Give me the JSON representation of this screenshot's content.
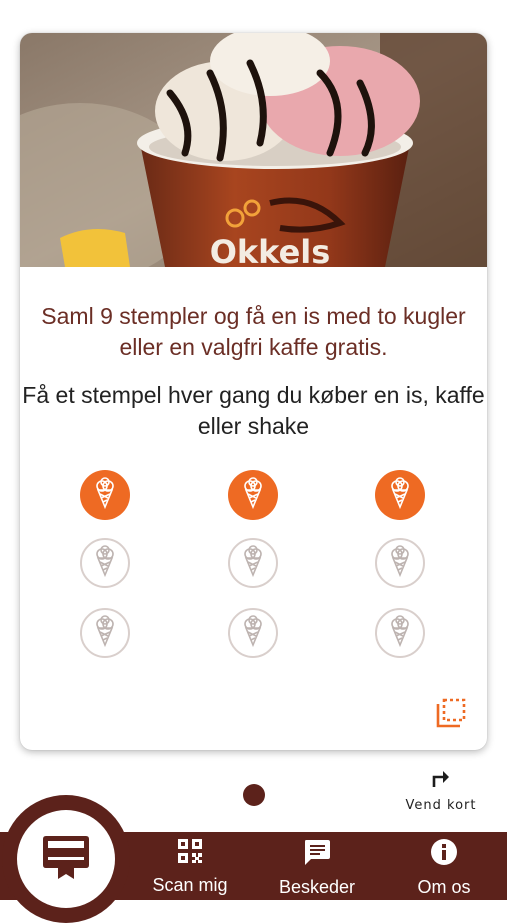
{
  "card": {
    "hero_image": {
      "alt_icon": "ice-cream-cup-photo",
      "brand_text": "Okkels"
    },
    "title": "Saml 9 stempler og få en is med to kugler eller en valgfri kaffe gratis.",
    "subtitle": "Få et stempel hver gang du køber en is, kaffe eller shake",
    "stamps": [
      {
        "filled": true
      },
      {
        "filled": true
      },
      {
        "filled": true
      },
      {
        "filled": false
      },
      {
        "filled": false
      },
      {
        "filled": false
      },
      {
        "filled": false
      },
      {
        "filled": false
      },
      {
        "filled": false
      }
    ],
    "stamps_collected": 3,
    "stamps_total": 9,
    "flip_icon": "flip-corner-icon"
  },
  "pager": {
    "current_page": 1
  },
  "flip_card": {
    "label": "Vend kort",
    "icon": "turn-right-arrow-icon"
  },
  "bottom_nav": {
    "home": {
      "icon": "card-ribbon-icon"
    },
    "items": [
      {
        "label": "Scan mig",
        "icon": "qr-code-icon"
      },
      {
        "label": "Beskeder",
        "icon": "message-icon"
      },
      {
        "label": "Om os",
        "icon": "info-icon"
      }
    ]
  },
  "colors": {
    "brand_brown": "#5c221b",
    "stamp_orange": "#ee6a23",
    "title_text": "#6b2e25"
  }
}
